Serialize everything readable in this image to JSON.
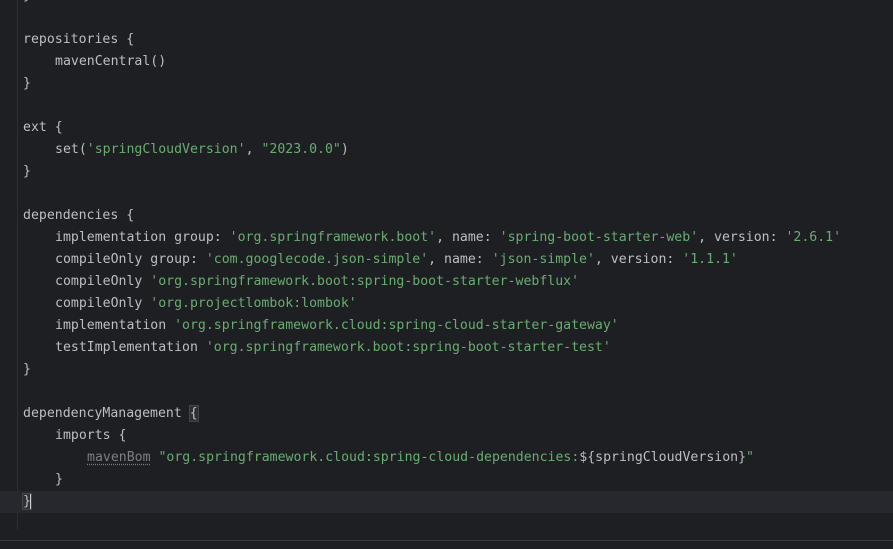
{
  "editor": {
    "lines": {
      "l1": "}",
      "l3": "repositories {",
      "l4": "mavenCentral()",
      "l5": "}",
      "l7": "ext {",
      "l8_fn": "set(",
      "l8_s1": "'springCloudVersion'",
      "l8_comma": ", ",
      "l8_s2": "\"2023.0.0\"",
      "l8_end": ")",
      "l9": "}",
      "l11": "dependencies {",
      "l12": {
        "fn": "implementation ",
        "g": "group: ",
        "gv": "'org.springframework.boot'",
        "n": ", name: ",
        "nv": "'spring-boot-starter-web'",
        "v": ", version: ",
        "vv": "'2.6.1'"
      },
      "l13": {
        "fn": "compileOnly ",
        "g": "group: ",
        "gv": "'com.googlecode.json-simple'",
        "n": ", name: ",
        "nv": "'json-simple'",
        "v": ", version: ",
        "vv": "'1.1.1'"
      },
      "l14": {
        "fn": "compileOnly ",
        "s": "'org.springframework.boot:spring-boot-starter-webflux'"
      },
      "l15": {
        "fn": "compileOnly ",
        "s": "'org.projectlombok:lombok'"
      },
      "l16": {
        "fn": "implementation ",
        "s": "'org.springframework.cloud:spring-cloud-starter-gateway'"
      },
      "l17": {
        "fn": "testImplementation ",
        "s": "'org.springframework.boot:spring-boot-starter-test'"
      },
      "l18": "}",
      "l20": "dependencyManagement ",
      "l20_brace": "{",
      "l21": "imports {",
      "l22": {
        "fn": "mavenBom",
        "sp": " ",
        "s": "\"org.springframework.cloud:spring-cloud-dependencies:",
        "interp": "${springCloudVersion}",
        "end": "\""
      },
      "l23": "}",
      "l24": "}"
    }
  },
  "colors": {
    "background": "#1e1f22",
    "text": "#bcbec4",
    "string": "#6aab73",
    "deprecated": "#7a7e85"
  }
}
